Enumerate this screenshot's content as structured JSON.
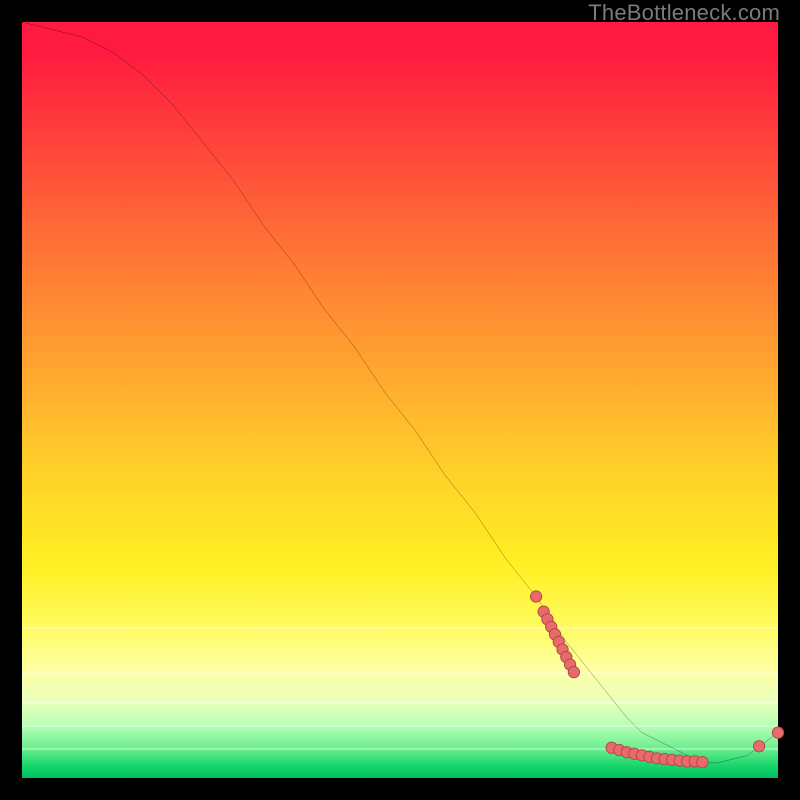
{
  "watermark": "TheBottleneck.com",
  "colors": {
    "curve": "#000000",
    "dot_fill": "#e96a6a",
    "dot_stroke": "#b04848"
  },
  "chart_data": {
    "type": "line",
    "title": "",
    "xlabel": "",
    "ylabel": "",
    "xlim": [
      0,
      100
    ],
    "ylim": [
      0,
      100
    ],
    "note": "Axes are unlabeled in the source image; x/y are normalized 0–100. Curve y-values are read as percentage height within the plot area (0 = bottom, 100 = top). Background hue maps roughly to y: red ≈ high, green ≈ low.",
    "series": [
      {
        "name": "bottleneck-curve",
        "x": [
          0,
          4,
          8,
          12,
          16,
          20,
          24,
          28,
          32,
          36,
          40,
          44,
          48,
          52,
          56,
          60,
          64,
          68,
          72,
          76,
          80,
          82,
          84,
          86,
          88,
          90,
          92,
          96,
          100
        ],
        "y": [
          100,
          99,
          98,
          96,
          93,
          89,
          84,
          79,
          73,
          68,
          62,
          57,
          51,
          46,
          40,
          35,
          29,
          24,
          18,
          13,
          8,
          6,
          5,
          4,
          3,
          2,
          2,
          3,
          6
        ]
      }
    ],
    "points": [
      {
        "name": "cluster-a",
        "x_range": [
          68,
          73
        ],
        "y_range": [
          14,
          25
        ],
        "pts": [
          [
            68,
            24
          ],
          [
            69,
            22
          ],
          [
            69.5,
            21
          ],
          [
            70,
            20
          ],
          [
            70.5,
            19
          ],
          [
            71,
            18
          ],
          [
            71.5,
            17
          ],
          [
            72,
            16
          ],
          [
            72.5,
            15
          ],
          [
            73,
            14
          ]
        ]
      },
      {
        "name": "cluster-b",
        "x_range": [
          78,
          90
        ],
        "y_range": [
          2,
          4
        ],
        "pts": [
          [
            78,
            4
          ],
          [
            79,
            3.7
          ],
          [
            80,
            3.4
          ],
          [
            81,
            3.2
          ],
          [
            82,
            3.0
          ],
          [
            83,
            2.8
          ],
          [
            84,
            2.6
          ],
          [
            85,
            2.5
          ],
          [
            86,
            2.4
          ],
          [
            87,
            2.3
          ],
          [
            88,
            2.2
          ],
          [
            89,
            2.2
          ],
          [
            90,
            2.1
          ]
        ]
      },
      {
        "name": "cluster-c",
        "x_range": [
          97,
          100
        ],
        "y_range": [
          4,
          6
        ],
        "pts": [
          [
            97.5,
            4.2
          ],
          [
            100,
            6
          ]
        ]
      }
    ]
  }
}
